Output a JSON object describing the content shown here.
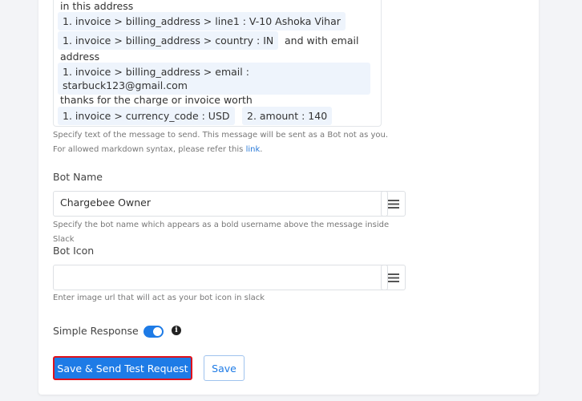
{
  "message": {
    "lines": [
      "in this address",
      "and with email",
      "address",
      "thanks for the charge or invoice worth"
    ],
    "chips": [
      "1. invoice > billing_address > line1 : V-10 Ashoka Vihar",
      "1. invoice > billing_address > country : IN",
      "1. invoice > billing_address > email :",
      "starbuck123@gmail.com",
      "1. invoice > currency_code : USD",
      "2. amount : 140"
    ],
    "help": "Specify text of the message to send. This message will be sent as a Bot not as you. For allowed markdown syntax, please refer this ",
    "help_link": "link",
    "help_end": "."
  },
  "bot_name": {
    "label": "Bot Name",
    "value": "Chargebee Owner",
    "help": "Specify the bot name which appears as a bold username above the message inside Slack"
  },
  "bot_icon": {
    "label": "Bot Icon",
    "value": "",
    "help": "Enter image url that will act as your bot icon in slack"
  },
  "simple_response": {
    "label": "Simple Response",
    "enabled": true,
    "info_glyph": "i"
  },
  "buttons": {
    "primary": "Save & Send Test Request",
    "save": "Save"
  },
  "colors": {
    "accent": "#1e7be6",
    "highlight": "#e0111b"
  }
}
